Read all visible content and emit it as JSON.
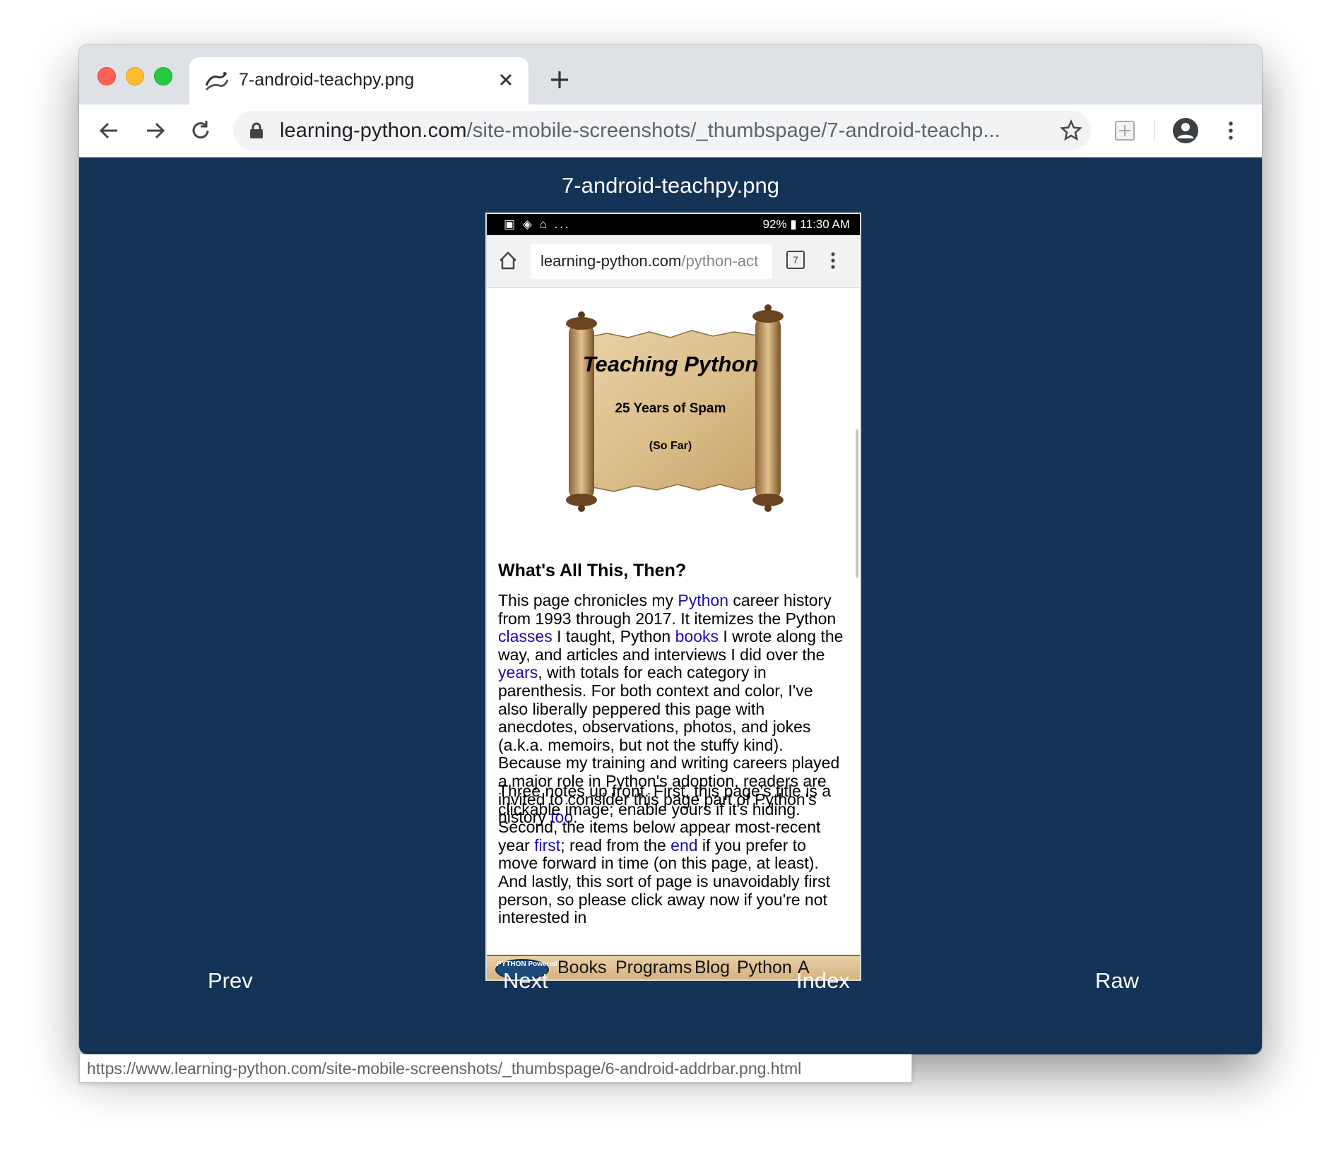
{
  "browser": {
    "tab": {
      "title": "7-android-teachpy.png",
      "favicon": "python-logo-icon"
    },
    "address": {
      "host": "learning-python.com",
      "path": "/site-mobile-screenshots/_thumbspage/7-android-teachp..."
    },
    "status_url": "https://www.learning-python.com/site-mobile-screenshots/_thumbspage/6-android-addrbar.png.html"
  },
  "page": {
    "heading": "7-android-teachpy.png",
    "nav": {
      "prev": "Prev",
      "next": "Next",
      "index": "Index",
      "raw": "Raw"
    }
  },
  "phone": {
    "status_left": "▣ ◈ ⌂ ...",
    "status_right": "92% ▮ 11:30 AM",
    "url_host": "learning-python.com",
    "url_path": "/python-act",
    "tab_count": "7",
    "scroll": {
      "title": "Teaching Python",
      "subtitle": "25 Years of Spam",
      "note": "(So Far)"
    },
    "heading": "What's All This, Then?",
    "p1": {
      "t1": "This page chronicles my ",
      "l1": "Python",
      "t2": " career history from 1993 through 2017. It itemizes the Python ",
      "l2": "classes",
      "t3": " I taught, Python ",
      "l3": "books",
      "t4": " I wrote along the way, and articles and interviews I did over the ",
      "l4": "years",
      "t5": ", with totals for each category in parenthesis. For both context and color, I've also liberally peppered this page with anecdotes, observations, photos, and jokes (a.k.a. memoirs, but not the stuffy kind). Because my training and writing careers played a major role in Python's adoption, readers are invited to consider this page part of Python's history ",
      "l5": "too",
      "t6": "."
    },
    "p2": {
      "t1": "Three notes up front. First, this page's title is a clickable image; enable yours if it's hiding. Second, the items below appear most-recent year ",
      "l1": "first",
      "t2": "; read from the ",
      "l2": "end",
      "t3": " if you prefer to move forward in time (on this page, at least). And lastly, this sort of page is unavoidably first person, so please click away now if you're not interested in"
    },
    "footer": {
      "badge": "PYTHON Powered",
      "items": [
        "Books",
        "Programs",
        "Blog",
        "Python",
        "A"
      ]
    }
  },
  "colors": {
    "page_bg": "#143356",
    "link": "#1a0dab",
    "footer_bg": "#d9b887"
  }
}
